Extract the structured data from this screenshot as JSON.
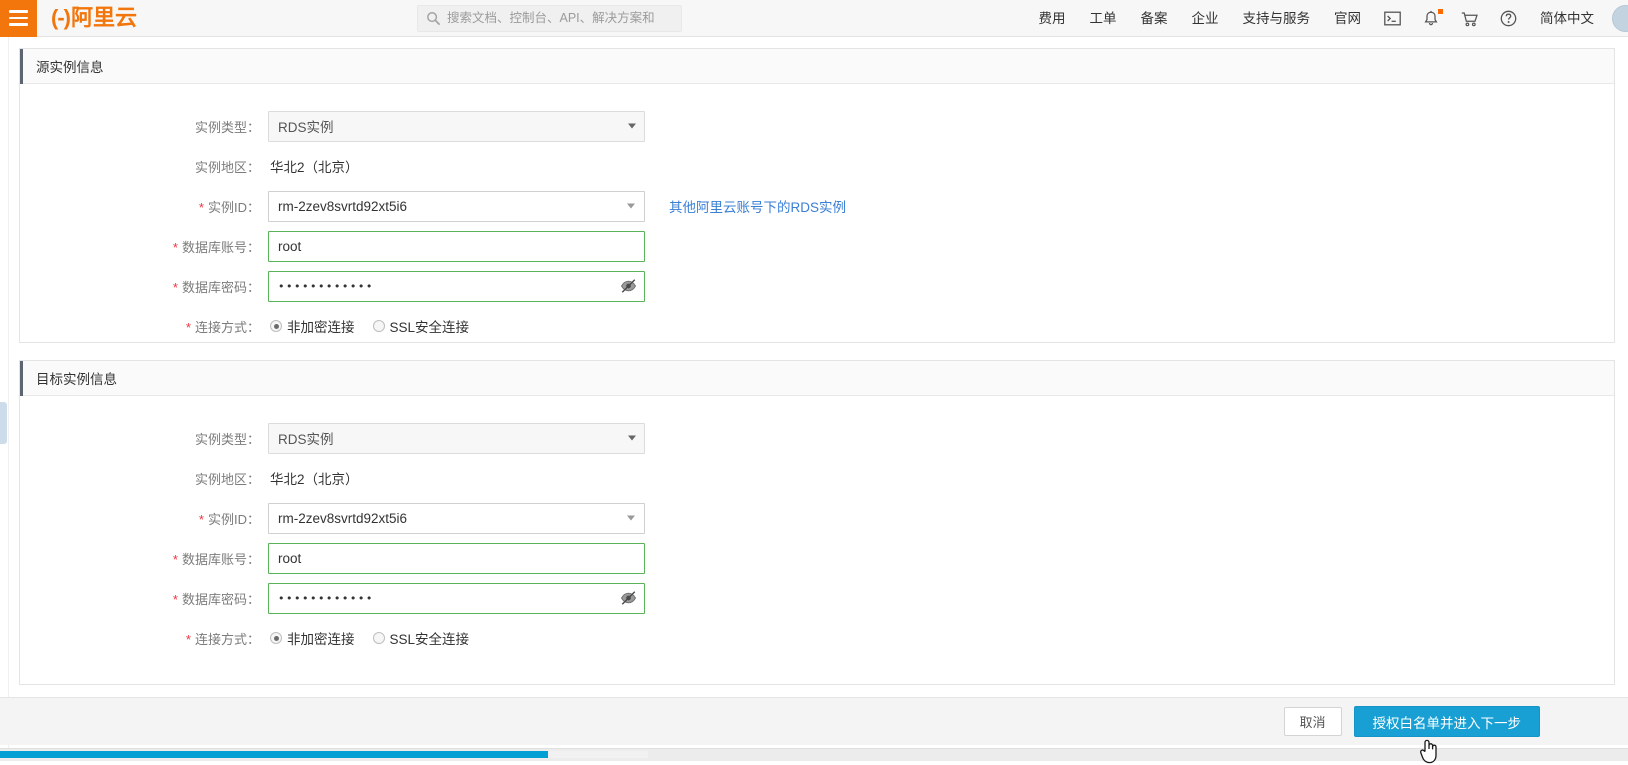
{
  "header": {
    "menu_icon": "hamburger-icon",
    "brand_mark": "(-)",
    "brand_text": "阿里云",
    "search": {
      "icon": "search-icon",
      "placeholder": "搜索文档、控制台、API、解决方案和"
    },
    "nav_items": [
      {
        "label": "费用"
      },
      {
        "label": "工单"
      },
      {
        "label": "备案"
      },
      {
        "label": "企业"
      },
      {
        "label": "支持与服务"
      },
      {
        "label": "官网"
      }
    ],
    "icons": [
      {
        "name": "console-terminal-icon"
      },
      {
        "name": "notification-bell-icon",
        "badge": true
      },
      {
        "name": "shopping-cart-icon"
      },
      {
        "name": "help-question-icon"
      }
    ],
    "language": "简体中文",
    "avatar": "user-avatar"
  },
  "source_section": {
    "title": "源实例信息",
    "fields": {
      "instance_type_label": "实例类型：",
      "instance_type_value": "RDS实例",
      "region_label": "实例地区：",
      "region_value": "华北2（北京）",
      "instance_id_label": "实例ID：",
      "instance_id_value": "rm-2zev8svrtd92xt5i6",
      "instance_id_link": "其他阿里云账号下的RDS实例",
      "db_account_label": "数据库账号：",
      "db_account_value": "root",
      "db_password_label": "数据库密码：",
      "db_password_value": "••••••••••••",
      "password_toggle_icon": "eye-slash-icon",
      "conn_label": "连接方式：",
      "conn_options": [
        {
          "label": "非加密连接",
          "selected": true
        },
        {
          "label": "SSL安全连接",
          "selected": false
        }
      ]
    }
  },
  "target_section": {
    "title": "目标实例信息",
    "fields": {
      "instance_type_label": "实例类型：",
      "instance_type_value": "RDS实例",
      "region_label": "实例地区：",
      "region_value": "华北2（北京）",
      "instance_id_label": "实例ID：",
      "instance_id_value": "rm-2zev8svrtd92xt5i6",
      "db_account_label": "数据库账号：",
      "db_account_value": "root",
      "db_password_label": "数据库密码：",
      "db_password_value": "••••••••••••",
      "password_toggle_icon": "eye-slash-icon",
      "conn_label": "连接方式：",
      "conn_options": [
        {
          "label": "非加密连接",
          "selected": true
        },
        {
          "label": "SSL安全连接",
          "selected": false
        }
      ]
    }
  },
  "footer": {
    "cancel_label": "取消",
    "next_label": "授权白名单并进入下一步"
  },
  "colors": {
    "brand_orange": "#f2760c",
    "primary_blue": "#18a0d4",
    "valid_green": "#5ab55a",
    "required_red": "#f4333c",
    "link_blue": "#3a7fd5",
    "scrollbar_blue": "#019fd4"
  },
  "required_marker": "*"
}
